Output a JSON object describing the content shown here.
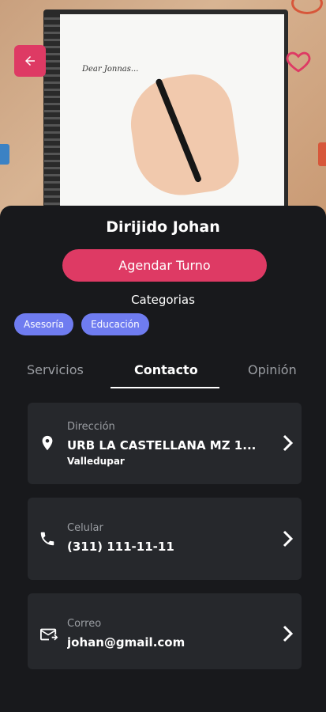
{
  "header": {
    "scribble_text": "Dear Jonnas...",
    "back_icon": "arrow-left-icon",
    "favorite_icon": "heart-outline-icon"
  },
  "profile": {
    "name": "Dirijido Johan",
    "cta_label": "Agendar Turno",
    "categories_title": "Categorias",
    "categories": [
      "Asesoría",
      "Educación"
    ]
  },
  "tabs": [
    {
      "label": "Servicios",
      "active": false
    },
    {
      "label": "Contacto",
      "active": true
    },
    {
      "label": "Opinión",
      "active": false
    }
  ],
  "contact": {
    "address": {
      "label": "Dirección",
      "value": "URB LA CASTELLANA MZ 1...",
      "city": "Valledupar",
      "icon": "location-pin-icon"
    },
    "phone": {
      "label": "Celular",
      "value": "(311) 111-11-11",
      "icon": "phone-icon"
    },
    "email": {
      "label": "Correo",
      "value": "johan@gmail.com",
      "icon": "mail-icon"
    }
  },
  "colors": {
    "accent": "#de3a64",
    "chip": "#6f7cf0",
    "background": "#18191c",
    "card": "#26282c"
  }
}
